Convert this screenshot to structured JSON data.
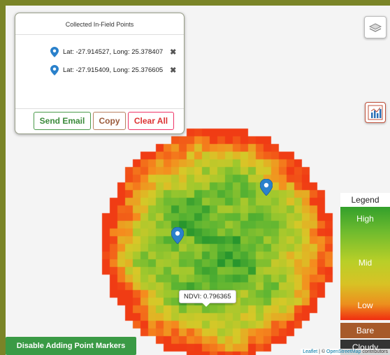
{
  "panel": {
    "title": "Collected In-Field Points",
    "points": [
      {
        "text": "Lat: -27.914527, Long: 25.378407",
        "remove_symbol": "✖"
      },
      {
        "text": "Lat: -27.915409, Long: 25.376605",
        "remove_symbol": "✖"
      }
    ],
    "buttons": {
      "send_email": "Send Email",
      "copy": "Copy",
      "clear_all": "Clear All"
    }
  },
  "controls": {
    "layers_icon": "layers-icon",
    "chart_icon": "chart-icon"
  },
  "legend": {
    "title": "Legend",
    "high": "High",
    "mid": "Mid",
    "low": "Low",
    "bare": "Bare",
    "cloudy": "Cloudy",
    "colors": {
      "high": "#33a02c",
      "mid": "#c8d028",
      "low": "#f02d10",
      "bare": "#a75a2a",
      "cloudy": "#333333"
    }
  },
  "tooltip": {
    "text": "NDVI: 0.796365"
  },
  "disable_button": "Disable Adding Point Markers",
  "attribution": {
    "leaflet": "Leaflet",
    "separator": " | © ",
    "osm": "OpenStreetMap",
    "rest": " contributors"
  },
  "colors": {
    "accent_green": "#3a9a45",
    "marker_blue": "#2a81cb"
  }
}
